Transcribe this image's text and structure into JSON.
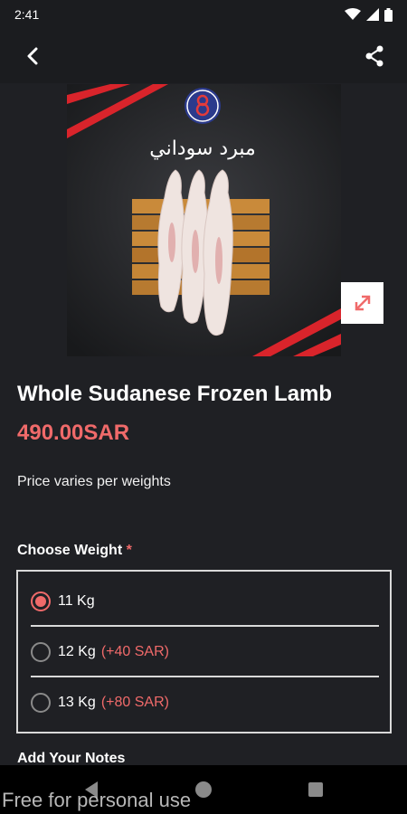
{
  "status": {
    "time": "2:41"
  },
  "image": {
    "arabic_title": "مبرد سوداني"
  },
  "product": {
    "title": "Whole Sudanese Frozen Lamb",
    "price": "490.00SAR",
    "price_note": "Price varies per weights"
  },
  "weight": {
    "heading": "Choose Weight",
    "required_mark": "*",
    "options": [
      {
        "label": "11 Kg",
        "extra": "",
        "selected": true
      },
      {
        "label": "12 Kg",
        "extra": "(+40 SAR)",
        "selected": false
      },
      {
        "label": "13 Kg",
        "extra": "(+80 SAR)",
        "selected": false
      }
    ]
  },
  "notes": {
    "heading": "Add Your Notes"
  },
  "watermark": "Free for personal use",
  "icons": {
    "back": "back-arrow-icon",
    "share": "share-icon",
    "expand": "expand-icon",
    "wifi": "wifi-icon",
    "signal": "signal-icon",
    "battery": "battery-icon"
  },
  "colors": {
    "accent": "#f06a6a",
    "background": "#1f2024",
    "bar": "#1b1c1f"
  }
}
